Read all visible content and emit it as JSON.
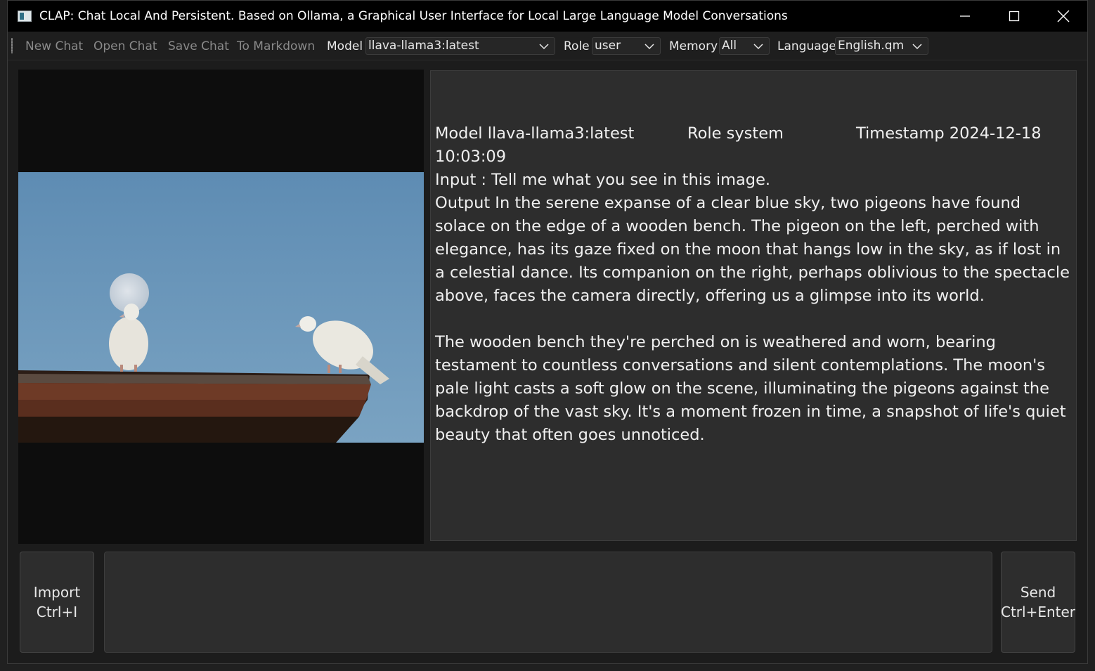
{
  "window": {
    "title": "CLAP: Chat Local And Persistent. Based on Ollama, a Graphical User Interface for Local Large Language Model Conversations"
  },
  "toolbar": {
    "new_chat": "New Chat",
    "open_chat": "Open Chat",
    "save_chat": "Save Chat",
    "to_markdown": "To Markdown",
    "model_label": "Model",
    "model_value": "llava-llama3:latest",
    "role_label": "Role",
    "role_value": "user",
    "memory_label": "Memory",
    "memory_value": "All",
    "language_label": "Language",
    "language_value": "English.qm"
  },
  "chat": {
    "model": "Model llava-llama3:latest",
    "role": "Role system",
    "timestamp_part1": "Timestamp 2024-12-18",
    "timestamp_part2": "10:03:09",
    "input": "Input : Tell me what you see in this image.",
    "output_p1": "Output In the serene expanse of a clear blue sky, two pigeons have found solace on the edge of a wooden bench. The pigeon on the left, perched with elegance, has its gaze fixed on the moon that hangs low in the sky, as if lost in a celestial dance. Its companion on the right, perhaps oblivious to the spectacle above, faces the camera directly, offering us a glimpse into its world.",
    "output_p2": "The wooden bench they're perched on is weathered and worn, bearing testament to countless conversations and silent contemplations. The moon's pale light casts a soft glow on the scene, illuminating the pigeons against the backdrop of the vast sky. It's a moment frozen in time, a snapshot of life's quiet beauty that often goes unnoticed."
  },
  "bottom": {
    "import_line1": "Import",
    "import_line2": "Ctrl+I",
    "send_line1": "Send",
    "send_line2": "Ctrl+Enter",
    "input_value": ""
  },
  "colors": {
    "sky": "#6d97ba",
    "wood": "#6b3524",
    "pane_bg": "#2d2d2d"
  },
  "icons": [
    "app-icon",
    "minimize-icon",
    "maximize-icon",
    "close-icon",
    "chevron-down-icon"
  ]
}
